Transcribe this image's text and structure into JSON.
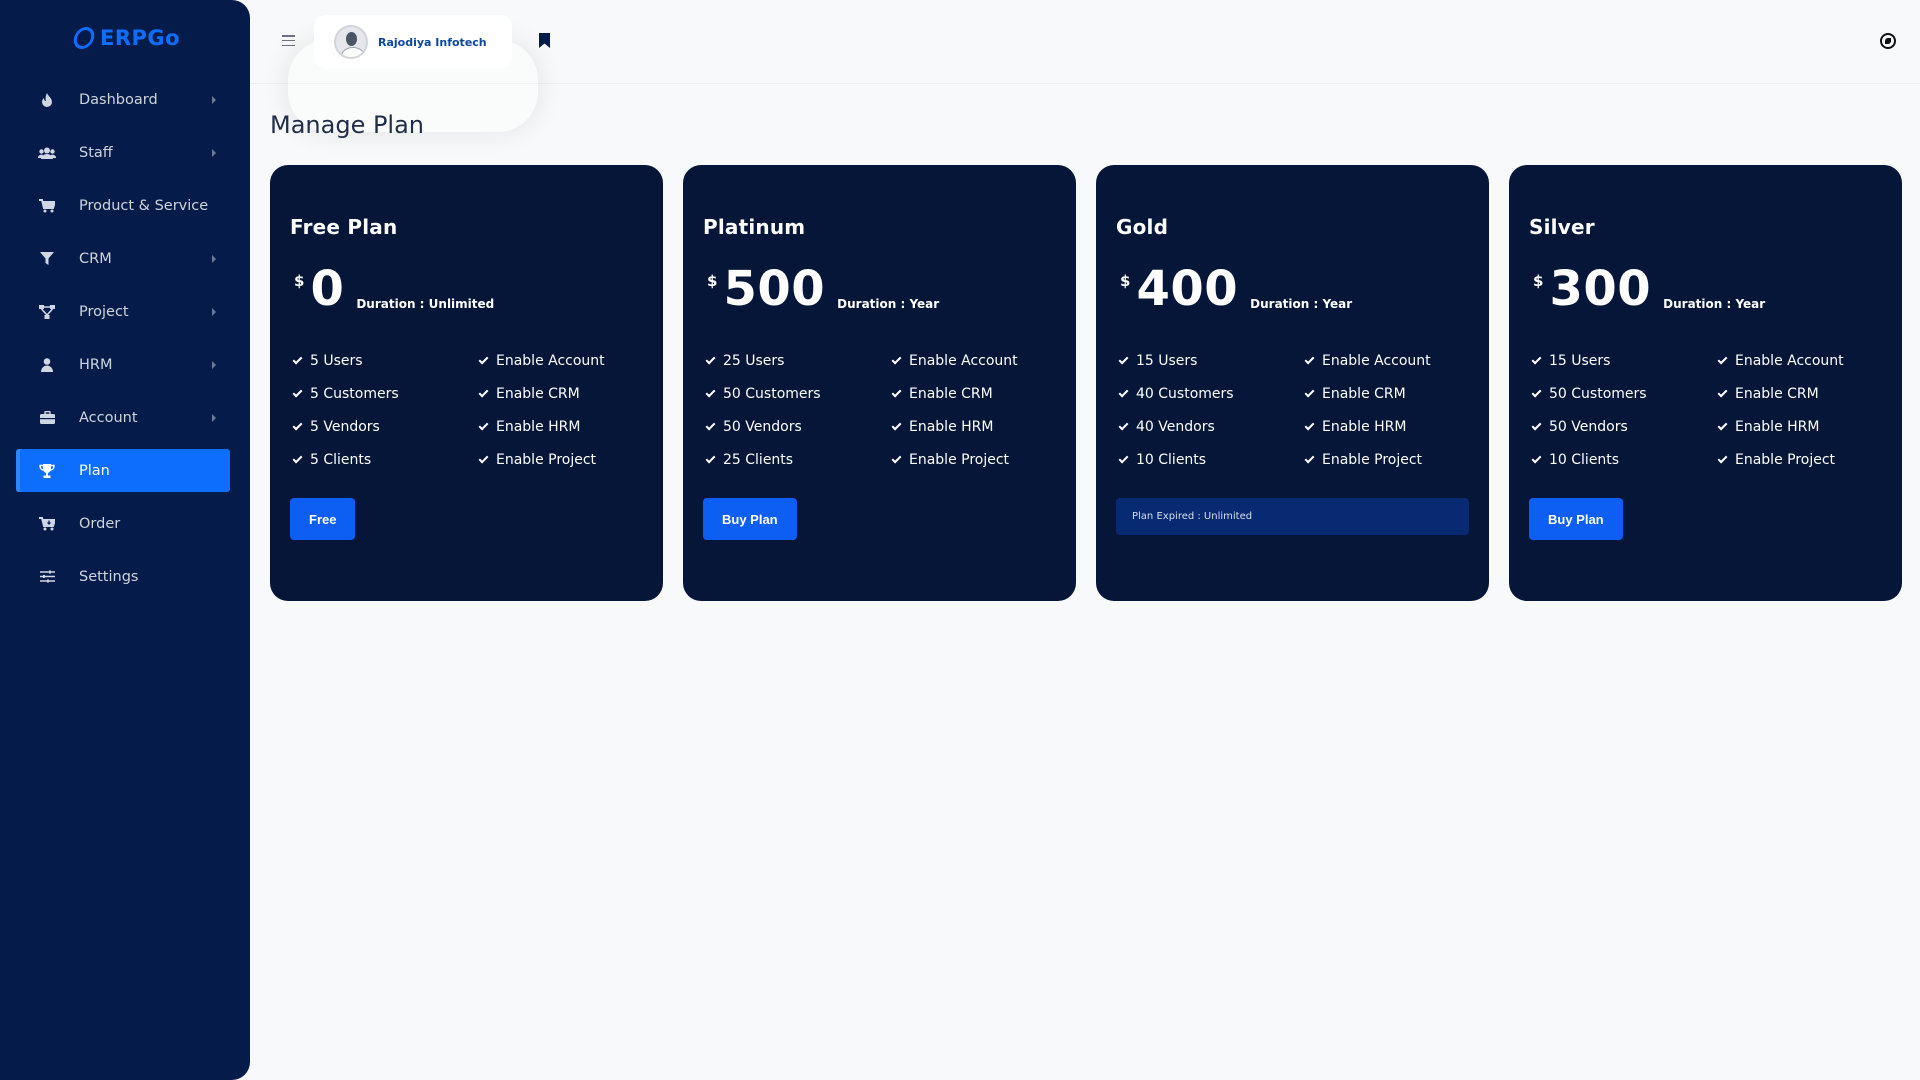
{
  "app": {
    "logo_text": "ERPGo",
    "brand_color": "#0d6efd"
  },
  "sidebar": {
    "items": [
      {
        "label": "Dashboard",
        "icon": "fire-icon",
        "has_caret": true,
        "active": false
      },
      {
        "label": "Staff",
        "icon": "users-icon",
        "has_caret": true,
        "active": false
      },
      {
        "label": "Product & Service",
        "icon": "cart-icon",
        "has_caret": false,
        "active": false
      },
      {
        "label": "CRM",
        "icon": "filter-icon",
        "has_caret": true,
        "active": false
      },
      {
        "label": "Project",
        "icon": "project-icon",
        "has_caret": true,
        "active": false
      },
      {
        "label": "HRM",
        "icon": "user-icon",
        "has_caret": true,
        "active": false
      },
      {
        "label": "Account",
        "icon": "briefcase-icon",
        "has_caret": true,
        "active": false
      },
      {
        "label": "Plan",
        "icon": "trophy-icon",
        "has_caret": false,
        "active": true
      },
      {
        "label": "Order",
        "icon": "cart-arrow-icon",
        "has_caret": false,
        "active": false
      },
      {
        "label": "Settings",
        "icon": "sliders-icon",
        "has_caret": false,
        "active": false
      }
    ]
  },
  "header": {
    "user_name": "Rajodiya Infotech"
  },
  "page": {
    "title": "Manage Plan"
  },
  "plans": [
    {
      "name": "Free Plan",
      "currency": "$",
      "price": "0",
      "duration": "Duration : Unlimited",
      "features_left": [
        "5 Users",
        "5 Customers",
        "5 Vendors",
        "5 Clients"
      ],
      "features_right": [
        "Enable Account",
        "Enable CRM",
        "Enable HRM",
        "Enable Project"
      ],
      "button_label": "Free"
    },
    {
      "name": "Platinum",
      "currency": "$",
      "price": "500",
      "duration": "Duration : Year",
      "features_left": [
        "25 Users",
        "50 Customers",
        "50 Vendors",
        "25 Clients"
      ],
      "features_right": [
        "Enable Account",
        "Enable CRM",
        "Enable HRM",
        "Enable Project"
      ],
      "button_label": "Buy Plan"
    },
    {
      "name": "Gold",
      "currency": "$",
      "price": "400",
      "duration": "Duration : Year",
      "features_left": [
        "15 Users",
        "40 Customers",
        "40 Vendors",
        "10 Clients"
      ],
      "features_right": [
        "Enable Account",
        "Enable CRM",
        "Enable HRM",
        "Enable Project"
      ],
      "expired_text": "Plan Expired : Unlimited"
    },
    {
      "name": "Silver",
      "currency": "$",
      "price": "300",
      "duration": "Duration : Year",
      "features_left": [
        "15 Users",
        "50 Customers",
        "50 Vendors",
        "10 Clients"
      ],
      "features_right": [
        "Enable Account",
        "Enable CRM",
        "Enable HRM",
        "Enable Project"
      ],
      "button_label": "Buy Plan"
    }
  ]
}
